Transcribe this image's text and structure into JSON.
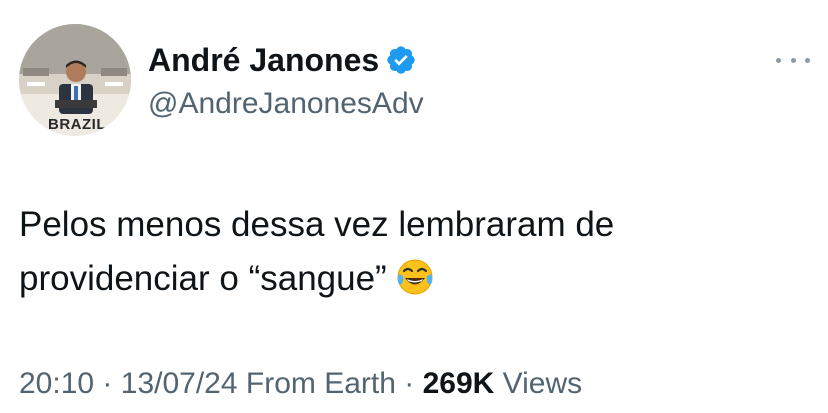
{
  "author": {
    "display_name": "André Janones",
    "handle": "@AndreJanonesAdv",
    "avatar_caption": "BRAZIL",
    "verified_color": "#1d9bf0"
  },
  "tweet": {
    "lines": [
      "Pelos menos dessa vez lembraram de",
      "providenciar o “sangue”"
    ],
    "emoji": "face-with-tears-of-joy"
  },
  "meta": {
    "time": "20:10",
    "separator": "·",
    "date": "13/07/24",
    "source": "From Earth",
    "views_count": "269K",
    "views_label": "Views"
  },
  "icons": {
    "more": "more-horizontal-icon",
    "verified": "verified-badge-icon"
  }
}
